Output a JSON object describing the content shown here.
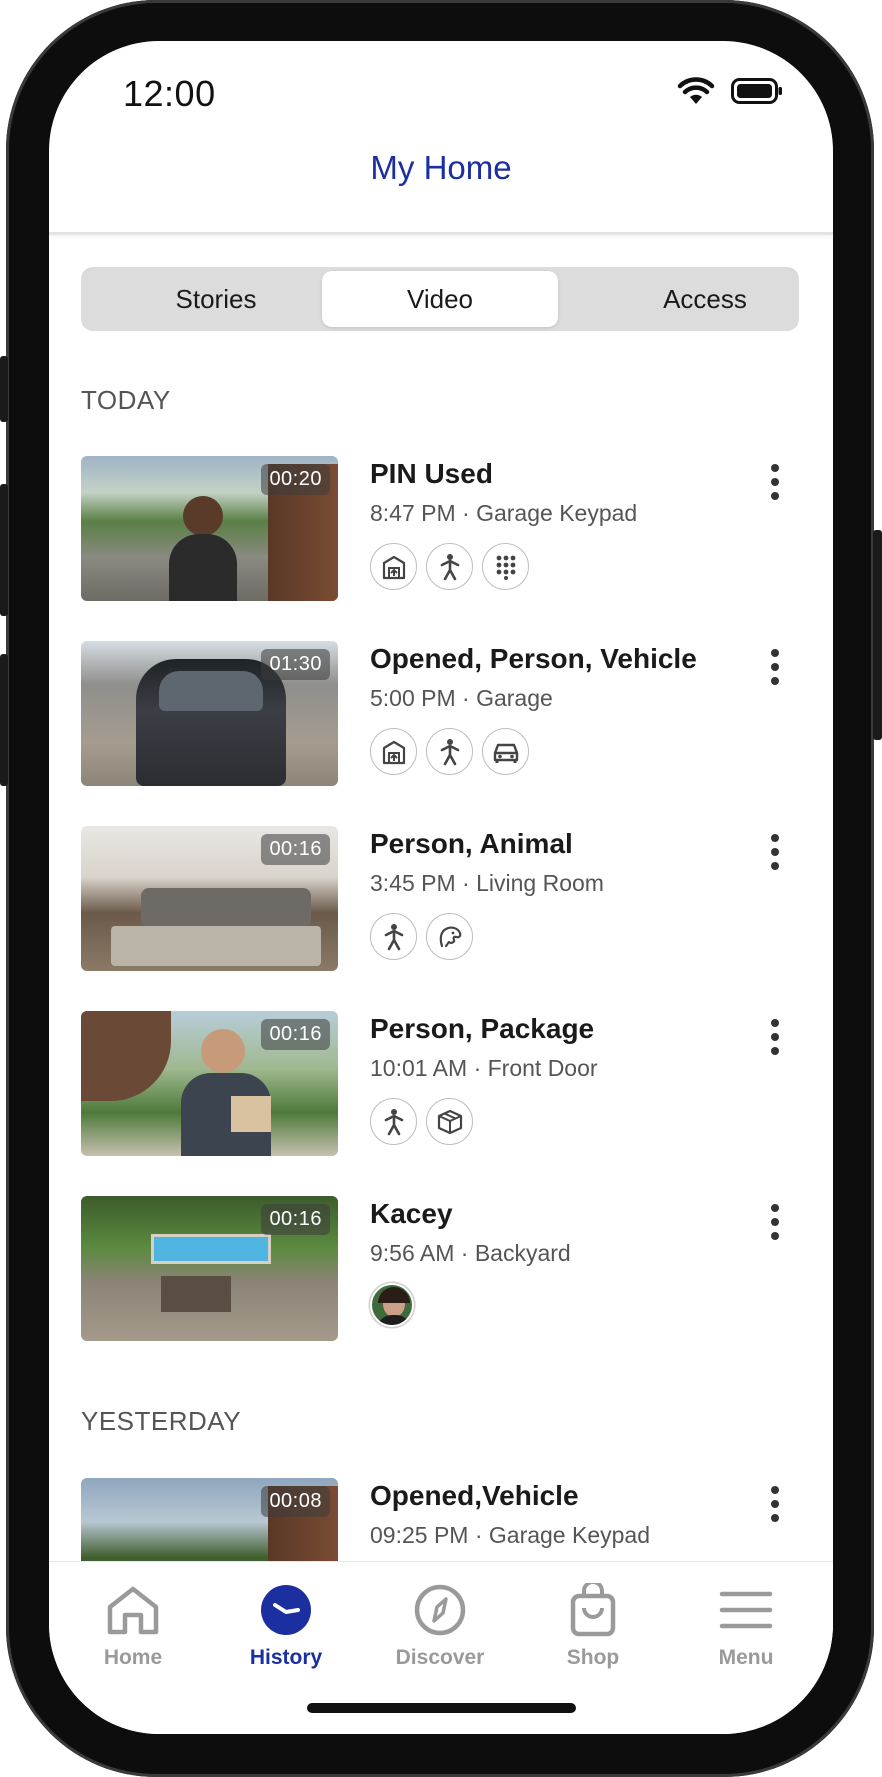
{
  "status_bar": {
    "time": "12:00"
  },
  "header": {
    "title": "My Home"
  },
  "tabs": [
    {
      "label": "Stories",
      "active": false
    },
    {
      "label": "Video",
      "active": true
    },
    {
      "label": "Access",
      "active": false
    }
  ],
  "sections": {
    "today": "TODAY",
    "yesterday": "YESTERDAY"
  },
  "events": [
    {
      "title": "PIN Used",
      "subtitle": "8:47 PM · Garage Keypad",
      "duration": "00:20",
      "tags": [
        "garage-icon",
        "person-icon",
        "keypad-icon"
      ]
    },
    {
      "title": "Opened, Person, Vehicle",
      "subtitle": "5:00 PM · Garage",
      "duration": "01:30",
      "tags": [
        "garage-icon",
        "person-icon",
        "car-icon"
      ]
    },
    {
      "title": "Person, Animal",
      "subtitle": "3:45 PM · Living Room",
      "duration": "00:16",
      "tags": [
        "person-icon",
        "animal-icon"
      ]
    },
    {
      "title": "Person, Package",
      "subtitle": "10:01 AM · Front Door",
      "duration": "00:16",
      "tags": [
        "person-icon",
        "package-icon"
      ]
    },
    {
      "title": "Kacey",
      "subtitle": "9:56 AM · Backyard",
      "duration": "00:16",
      "tags": [
        "face-avatar"
      ]
    },
    {
      "title": "Opened,Vehicle",
      "subtitle": "09:25 PM · Garage Keypad",
      "duration": "00:08",
      "tags": []
    }
  ],
  "bottom_nav": [
    {
      "label": "Home",
      "icon": "home-icon",
      "active": false
    },
    {
      "label": "History",
      "icon": "history-icon",
      "active": true
    },
    {
      "label": "Discover",
      "icon": "compass-icon",
      "active": false
    },
    {
      "label": "Shop",
      "icon": "shop-bag-icon",
      "active": false
    },
    {
      "label": "Menu",
      "icon": "menu-icon",
      "active": false
    }
  ],
  "colors": {
    "accent": "#1c2fa0",
    "segment_bg": "#dcdcdc",
    "inactive_nav": "#9a9a9a"
  }
}
